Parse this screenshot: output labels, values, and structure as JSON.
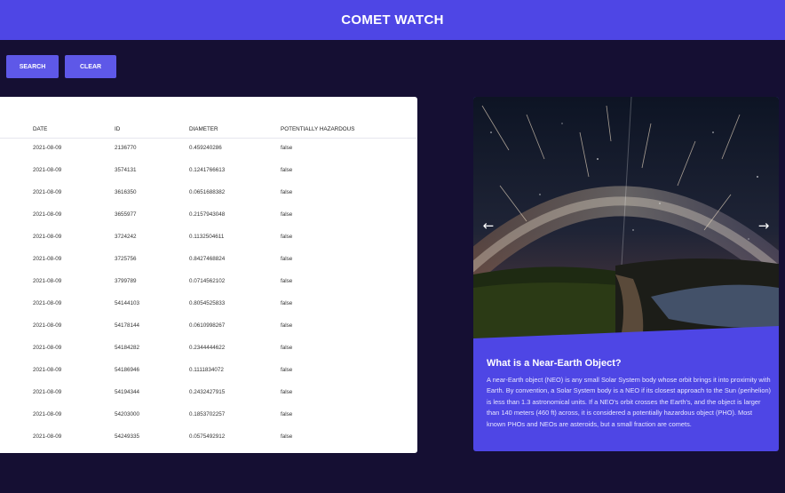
{
  "header": {
    "title": "COMET WATCH"
  },
  "toolbar": {
    "search_label": "SEARCH",
    "clear_label": "CLEAR"
  },
  "table": {
    "headers": [
      "DATE",
      "ID",
      "DIAMETER",
      "POTENTIALLY HAZARDOUS"
    ],
    "rows": [
      [
        "2021-08-09",
        "2136770",
        "0.459240286",
        "false"
      ],
      [
        "2021-08-09",
        "3574131",
        "0.1241766613",
        "false"
      ],
      [
        "2021-08-09",
        "3616350",
        "0.0651688382",
        "false"
      ],
      [
        "2021-08-09",
        "3655977",
        "0.2157943048",
        "false"
      ],
      [
        "2021-08-09",
        "3724242",
        "0.1132504611",
        "false"
      ],
      [
        "2021-08-09",
        "3725756",
        "0.8427468824",
        "false"
      ],
      [
        "2021-08-09",
        "3799789",
        "0.0714562102",
        "false"
      ],
      [
        "2021-08-09",
        "54144103",
        "0.8054525833",
        "false"
      ],
      [
        "2021-08-09",
        "54178144",
        "0.0610998267",
        "false"
      ],
      [
        "2021-08-09",
        "54184282",
        "0.2344444622",
        "false"
      ],
      [
        "2021-08-09",
        "54186946",
        "0.1111834072",
        "false"
      ],
      [
        "2021-08-09",
        "54194344",
        "0.2432427915",
        "false"
      ],
      [
        "2021-08-09",
        "54203000",
        "0.1853702257",
        "false"
      ],
      [
        "2021-08-09",
        "54249335",
        "0.0575492912",
        "false"
      ]
    ]
  },
  "carousel": {
    "prev_icon": "arrow-left-icon",
    "next_icon": "arrow-right-icon",
    "prev_glyph": "←",
    "next_glyph": "→"
  },
  "info": {
    "title": "What is a Near-Earth Object?",
    "text": "A near-Earth object (NEO) is any small Solar System body whose orbit brings it into proximity with Earth. By convention, a Solar System body is a NEO if its closest approach to the Sun (perihelion) is less than 1.3 astronomical units. If a NEO's orbit crosses the Earth's, and the object is larger than 140 meters (460 ft) across, it is considered a potentially hazardous object (PHO). Most known PHOs and NEOs are asteroids, but a small fraction are comets."
  },
  "colors": {
    "header": "#4e46e5",
    "background": "#150f33",
    "button": "#5e58e8",
    "card": "#4e46e5"
  }
}
